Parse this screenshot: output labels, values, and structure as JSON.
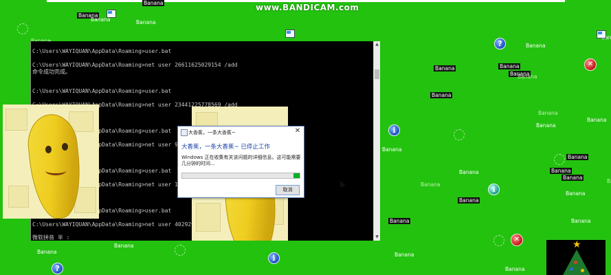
{
  "watermark": "www.BANDICAM.com",
  "console": {
    "lines": [
      "C:\\Users\\WAYIQUAN\\AppData\\Roaming>user.bat",
      "C:\\Users\\WAYIQUAN\\AppData\\Roaming>net user 26611625029154 /add",
      "命令成功完成。",
      "C:\\Users\\WAYIQUAN\\AppData\\Roaming>user.bat",
      "C:\\Users\\WAYIQUAN\\AppData\\Roaming>net user 23441225778569 /add",
      "C:\\Users\\WAYIQUAN\\AppData\\Roaming>user.bat",
      "C:\\Users\\WAYIQUAN\\AppData\\Roaming>net user 92128930",
      "C:\\Users\\WAYIQUAN\\AppData\\Roaming>user.bat",
      "C:\\Users\\WAYIQUAN\\AppData\\Roaming>net user 12990155",
      "C:\\Users\\WAYIQUAN\\AppData\\Roaming>user.bat",
      "C:\\Users\\WAYIQUAN\\AppData\\Roaming>net user 402929040101 /add",
      "微软拼音 半 :"
    ]
  },
  "dialog": {
    "title": "大香蕉，一条大香蕉~",
    "heading": "大香蕉，一条大香蕉~ 已停止工作",
    "body": "Windows 正在收集有关该问题的详细信息。这可能需要几分钟的时间...",
    "progress_fraction": 0.05,
    "cancel_label": "取消"
  },
  "banana_label": "Banana",
  "colors": {
    "desktop": "#23c20f",
    "progress": "#06b025",
    "heading": "#1a3fa8"
  }
}
